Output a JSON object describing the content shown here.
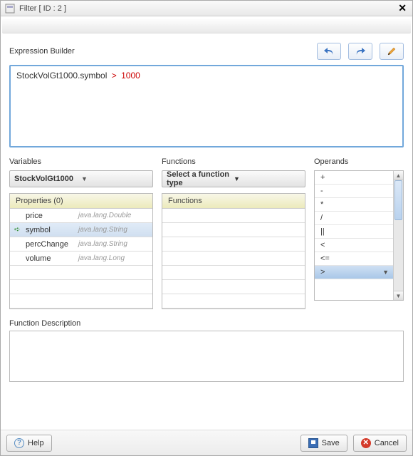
{
  "window": {
    "title": "Filter [ ID : 2 ]"
  },
  "sections": {
    "expression_builder": "Expression Builder",
    "variables": "Variables",
    "functions": "Functions",
    "operands": "Operands",
    "function_description": "Function Description"
  },
  "expression": {
    "lhs": "StockVolGt1000.symbol",
    "op": ">",
    "rhs": "1000"
  },
  "variables": {
    "dropdown_selected": "StockVolGt1000",
    "grid_header": "Properties (0)",
    "rows": [
      {
        "name": "price",
        "type": "java.lang.Double",
        "selected": false
      },
      {
        "name": "symbol",
        "type": "java.lang.String",
        "selected": true
      },
      {
        "name": "percChange",
        "type": "java.lang.String",
        "selected": false
      },
      {
        "name": "volume",
        "type": "java.lang.Long",
        "selected": false
      }
    ]
  },
  "functions": {
    "dropdown_placeholder": "Select a function type",
    "grid_header": "Functions"
  },
  "operands": {
    "items": [
      "+",
      "-",
      "*",
      "/",
      "||",
      "<",
      "<=",
      ">"
    ],
    "selected_index": 7
  },
  "buttons": {
    "help": "Help",
    "save": "Save",
    "cancel": "Cancel"
  },
  "icons": {
    "undo": "undo-icon",
    "redo": "redo-icon",
    "edit": "pencil-icon"
  }
}
